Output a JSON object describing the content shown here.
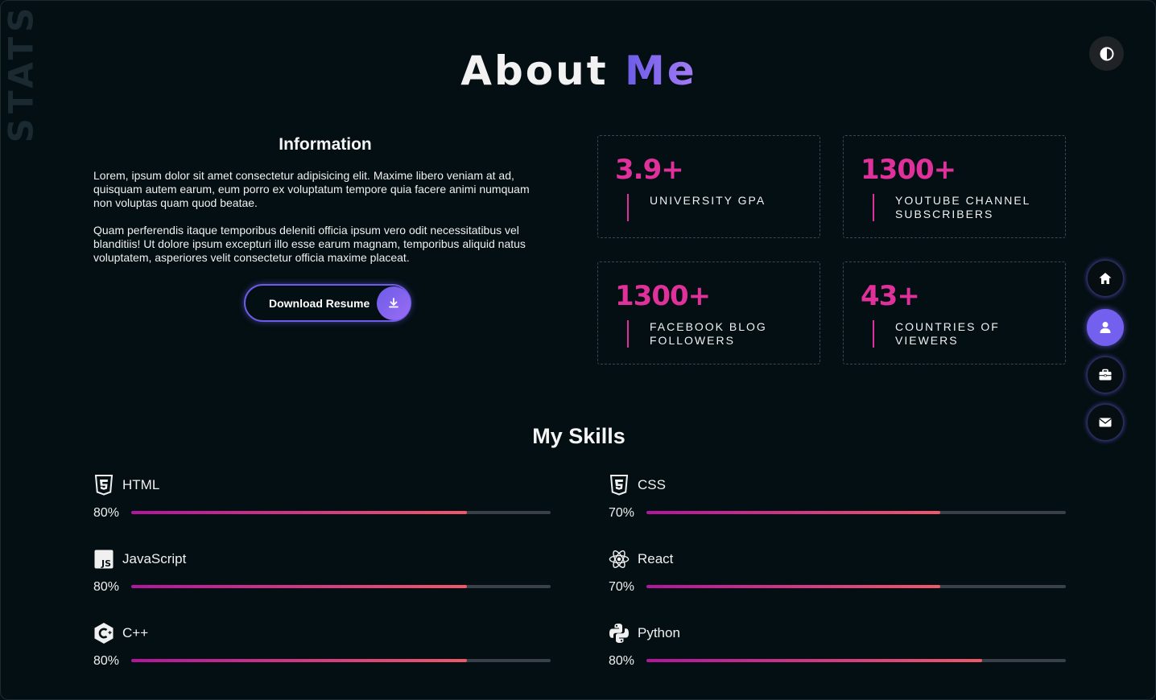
{
  "watermark": "STATS",
  "header": {
    "title_first": "About",
    "title_second": "Me"
  },
  "info": {
    "heading": "Information",
    "paragraphs": [
      "Lorem, ipsum dolor sit amet consectetur adipisicing elit. Maxime libero veniam at ad, quisquam autem earum, eum porro ex voluptatum tempore quia facere animi numquam non voluptas quam quod beatae.",
      "Quam perferendis itaque temporibus deleniti officia ipsum vero odit necessitatibus vel blanditiis! Ut dolore ipsum excepturi illo esse earum magnam, temporibus aliquid natus voluptatem, asperiores velit consectetur officia maxime placeat."
    ],
    "resume_button": "Download Resume",
    "resume_icon": "download-icon"
  },
  "stats": [
    {
      "value": "3.9+",
      "label": "University GPA"
    },
    {
      "value": "1300+",
      "label": "YouTube Channel Subscribers"
    },
    {
      "value": "1300+",
      "label": "Facebook Blog Followers"
    },
    {
      "value": "43+",
      "label": "Countries of Viewers"
    }
  ],
  "nav": [
    {
      "name": "home",
      "icon": "home-icon",
      "active": false
    },
    {
      "name": "about",
      "icon": "user-icon",
      "active": true
    },
    {
      "name": "portfolio",
      "icon": "briefcase-icon",
      "active": false
    },
    {
      "name": "contact",
      "icon": "envelope-icon",
      "active": false
    }
  ],
  "theme_toggle_icon": "contrast-icon",
  "skills_heading": "My Skills",
  "skills": [
    {
      "name": "HTML",
      "percent_label": "80%",
      "level": 80,
      "icon": "html5-icon"
    },
    {
      "name": "CSS",
      "percent_label": "70%",
      "level": 70,
      "icon": "css3-icon"
    },
    {
      "name": "JavaScript",
      "percent_label": "80%",
      "level": 80,
      "icon": "javascript-icon"
    },
    {
      "name": "React",
      "percent_label": "70%",
      "level": 70,
      "icon": "react-icon"
    },
    {
      "name": "C++",
      "percent_label": "80%",
      "level": 80,
      "icon": "cplusplus-icon"
    },
    {
      "name": "Python",
      "percent_label": "80%",
      "level": 80,
      "icon": "python-icon"
    }
  ],
  "colors": {
    "accent": "#6c5ce7",
    "stat": "#e0309a",
    "background": "#040f13"
  }
}
